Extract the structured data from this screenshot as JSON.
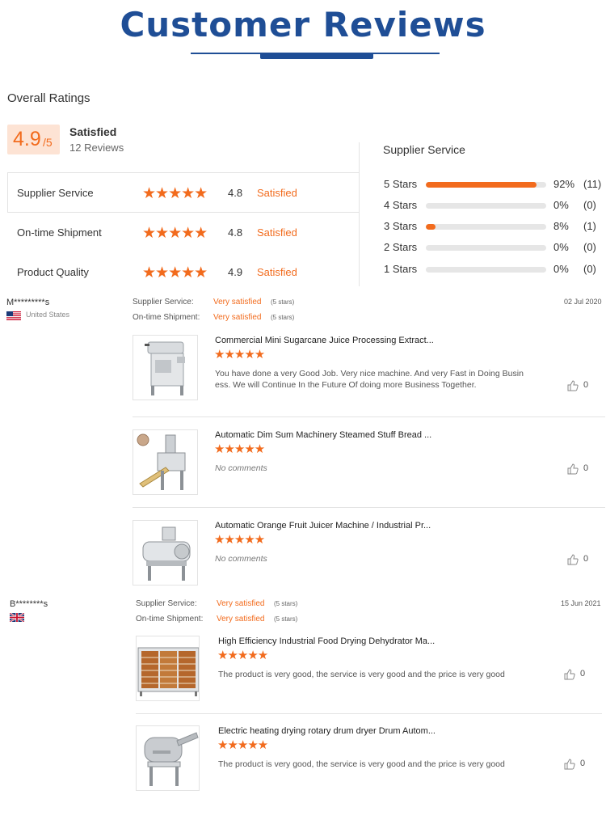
{
  "header": {
    "title": "Customer Reviews"
  },
  "overall": {
    "title": "Overall Ratings",
    "score": "4.9",
    "score_suffix": "/5",
    "label": "Satisfied",
    "reviews": "12 Reviews",
    "categories": [
      {
        "label": "Supplier Service",
        "stars": "★★★★★",
        "value": "4.8",
        "text": "Satisfied"
      },
      {
        "label": "On-time Shipment",
        "stars": "★★★★★",
        "value": "4.8",
        "text": "Satisfied"
      },
      {
        "label": "Product Quality",
        "stars": "★★★★★",
        "value": "4.9",
        "text": "Satisfied"
      }
    ]
  },
  "distribution": {
    "title": "Supplier Service",
    "rows": [
      {
        "label": "5 Stars",
        "pct": "92%",
        "count": "(11)",
        "fraction": 0.92
      },
      {
        "label": "4 Stars",
        "pct": "0%",
        "count": "(0)",
        "fraction": 0
      },
      {
        "label": "3 Stars",
        "pct": "8%",
        "count": "(1)",
        "fraction": 0.08
      },
      {
        "label": "2 Stars",
        "pct": "0%",
        "count": "(0)",
        "fraction": 0
      },
      {
        "label": "1 Stars",
        "pct": "0%",
        "count": "(0)",
        "fraction": 0
      }
    ]
  },
  "reviews": [
    {
      "name": "M*********s",
      "country": "United States",
      "flag": "us-flag-icon",
      "date": "02 Jul 2020",
      "service_label": "Supplier Service:",
      "service_value": "Very satisfied",
      "service_stars": "(5 stars)",
      "shipment_label": "On-time Shipment:",
      "shipment_value": "Very satisfied",
      "shipment_stars": "(5 stars)",
      "products": [
        {
          "title": "Commercial Mini Sugarcane Juice Processing Extract...",
          "stars": "★★★★★",
          "comment": "You have done a very Good Job. Very nice machine. And very Fast in Doing Busin ess. We will Continue In the Future Of doing more Business Together.",
          "likes": "0"
        },
        {
          "title": "Automatic Dim Sum Machinery Steamed Stuff Bread ...",
          "stars": "★★★★★",
          "comment": "No comments",
          "likes": "0"
        },
        {
          "title": "Automatic Orange Fruit Juicer Machine / Industrial Pr...",
          "stars": "★★★★★",
          "comment": "No comments",
          "likes": "0"
        }
      ]
    },
    {
      "name": "B********s",
      "country": "",
      "flag": "uk-flag-icon",
      "date": "15 Jun 2021",
      "service_label": "Supplier Service:",
      "service_value": "Very satisfied",
      "service_stars": "(5 stars)",
      "shipment_label": "On-time Shipment:",
      "shipment_value": "Very satisfied",
      "shipment_stars": "(5 stars)",
      "products": [
        {
          "title": "High Efficiency Industrial Food Drying Dehydrator Ma...",
          "stars": "★★★★★",
          "comment": "The product is very good, the service is very good and the price is very good",
          "likes": "0"
        },
        {
          "title": "Electric heating drying rotary drum dryer Drum Autom...",
          "stars": "★★★★★",
          "comment": "The product is very good, the service is very good and the price is very good",
          "likes": "0"
        }
      ]
    }
  ],
  "colors": {
    "accent": "#f26b1d",
    "brand": "#1f4e96",
    "score_bg": "#fde3d4"
  }
}
